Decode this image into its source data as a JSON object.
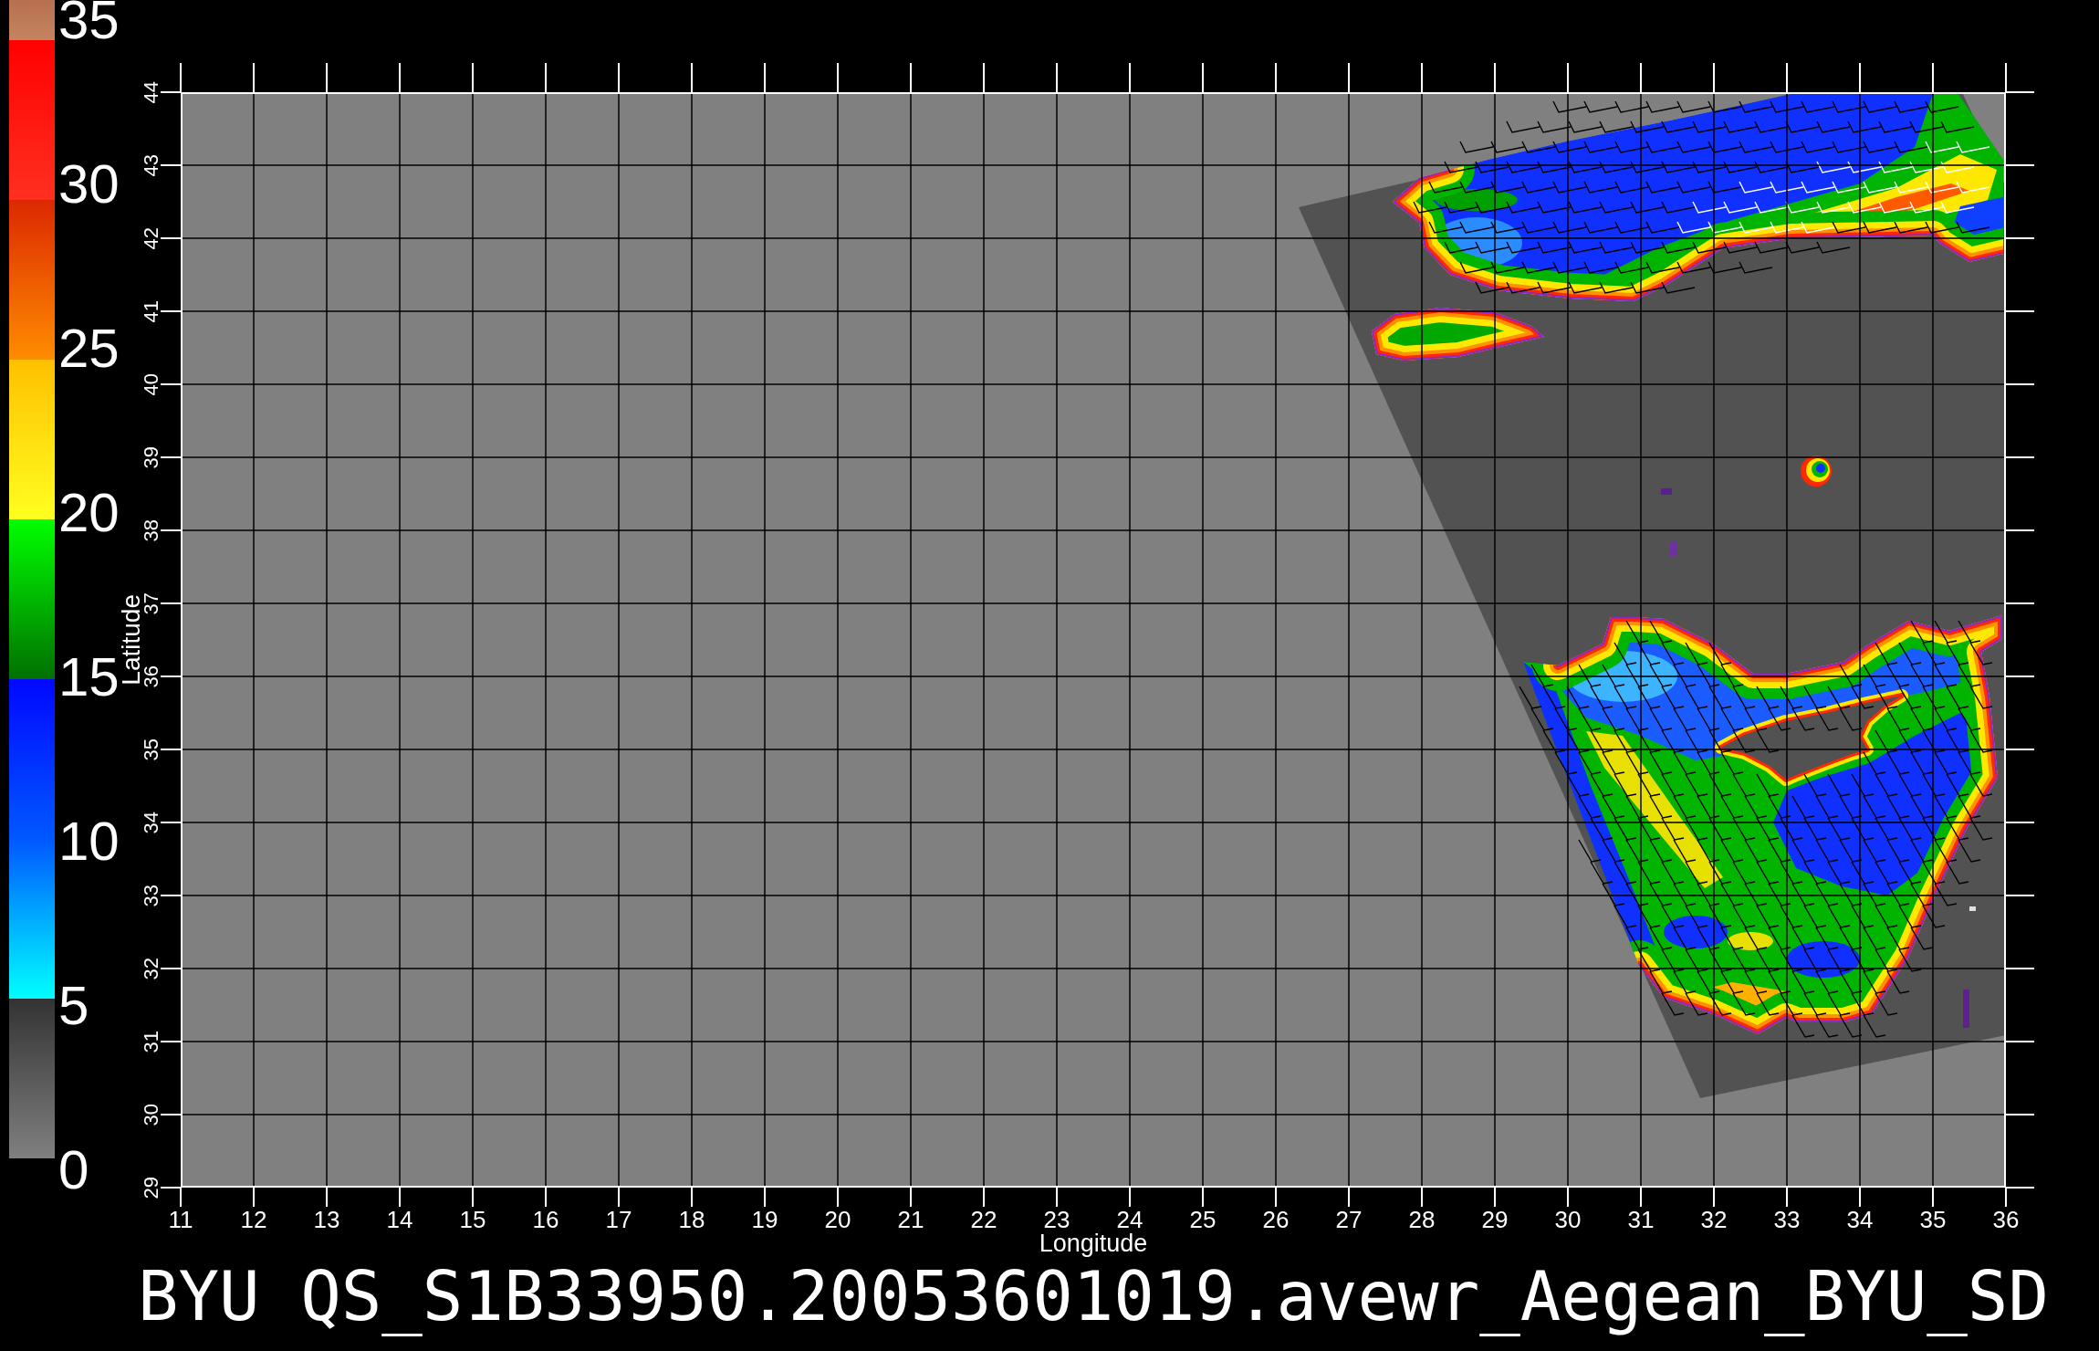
{
  "colorbar": {
    "bands": [
      {
        "stops": [
          {
            "color": "#c4845e"
          },
          {
            "color": "#b87050"
          }
        ]
      },
      {
        "stops": [
          {
            "color": "#ff3020"
          },
          {
            "color": "#ff0000"
          }
        ]
      },
      {
        "stops": [
          {
            "color": "#ff8c00"
          },
          {
            "color": "#dc2800"
          }
        ]
      },
      {
        "stops": [
          {
            "color": "#ffff20"
          },
          {
            "color": "#ffc000"
          }
        ]
      },
      {
        "stops": [
          {
            "color": "#007000"
          },
          {
            "color": "#00ff00"
          }
        ]
      },
      {
        "stops": [
          {
            "color": "#0058ff"
          },
          {
            "color": "#0008ff"
          }
        ]
      },
      {
        "stops": [
          {
            "color": "#00ffff"
          },
          {
            "color": "#0058ff"
          }
        ]
      },
      {
        "stops": [
          {
            "color": "#808080"
          },
          {
            "color": "#333333"
          }
        ]
      }
    ],
    "labels": [
      "35",
      "30",
      "25",
      "20",
      "15",
      "10",
      "5",
      "0"
    ]
  },
  "map": {
    "y_axis": {
      "title": "Latitude",
      "ticks": [
        "44",
        "43",
        "42",
        "41",
        "40",
        "39",
        "38",
        "37",
        "36",
        "35",
        "34",
        "33",
        "32",
        "31",
        "30",
        "29"
      ]
    },
    "x_axis": {
      "ticks": [
        "11",
        "12",
        "13",
        "14",
        "15",
        "16",
        "17",
        "18",
        "19",
        "20",
        "21",
        "22",
        "23",
        "24",
        "25",
        "26",
        "27",
        "28",
        "29",
        "30",
        "31",
        "32",
        "33",
        "34",
        "35",
        "36"
      ],
      "title": "Longitude"
    }
  },
  "title": "BYU QS_S1B33950.20053601019.avewr_Aegean_BYU_SD"
}
